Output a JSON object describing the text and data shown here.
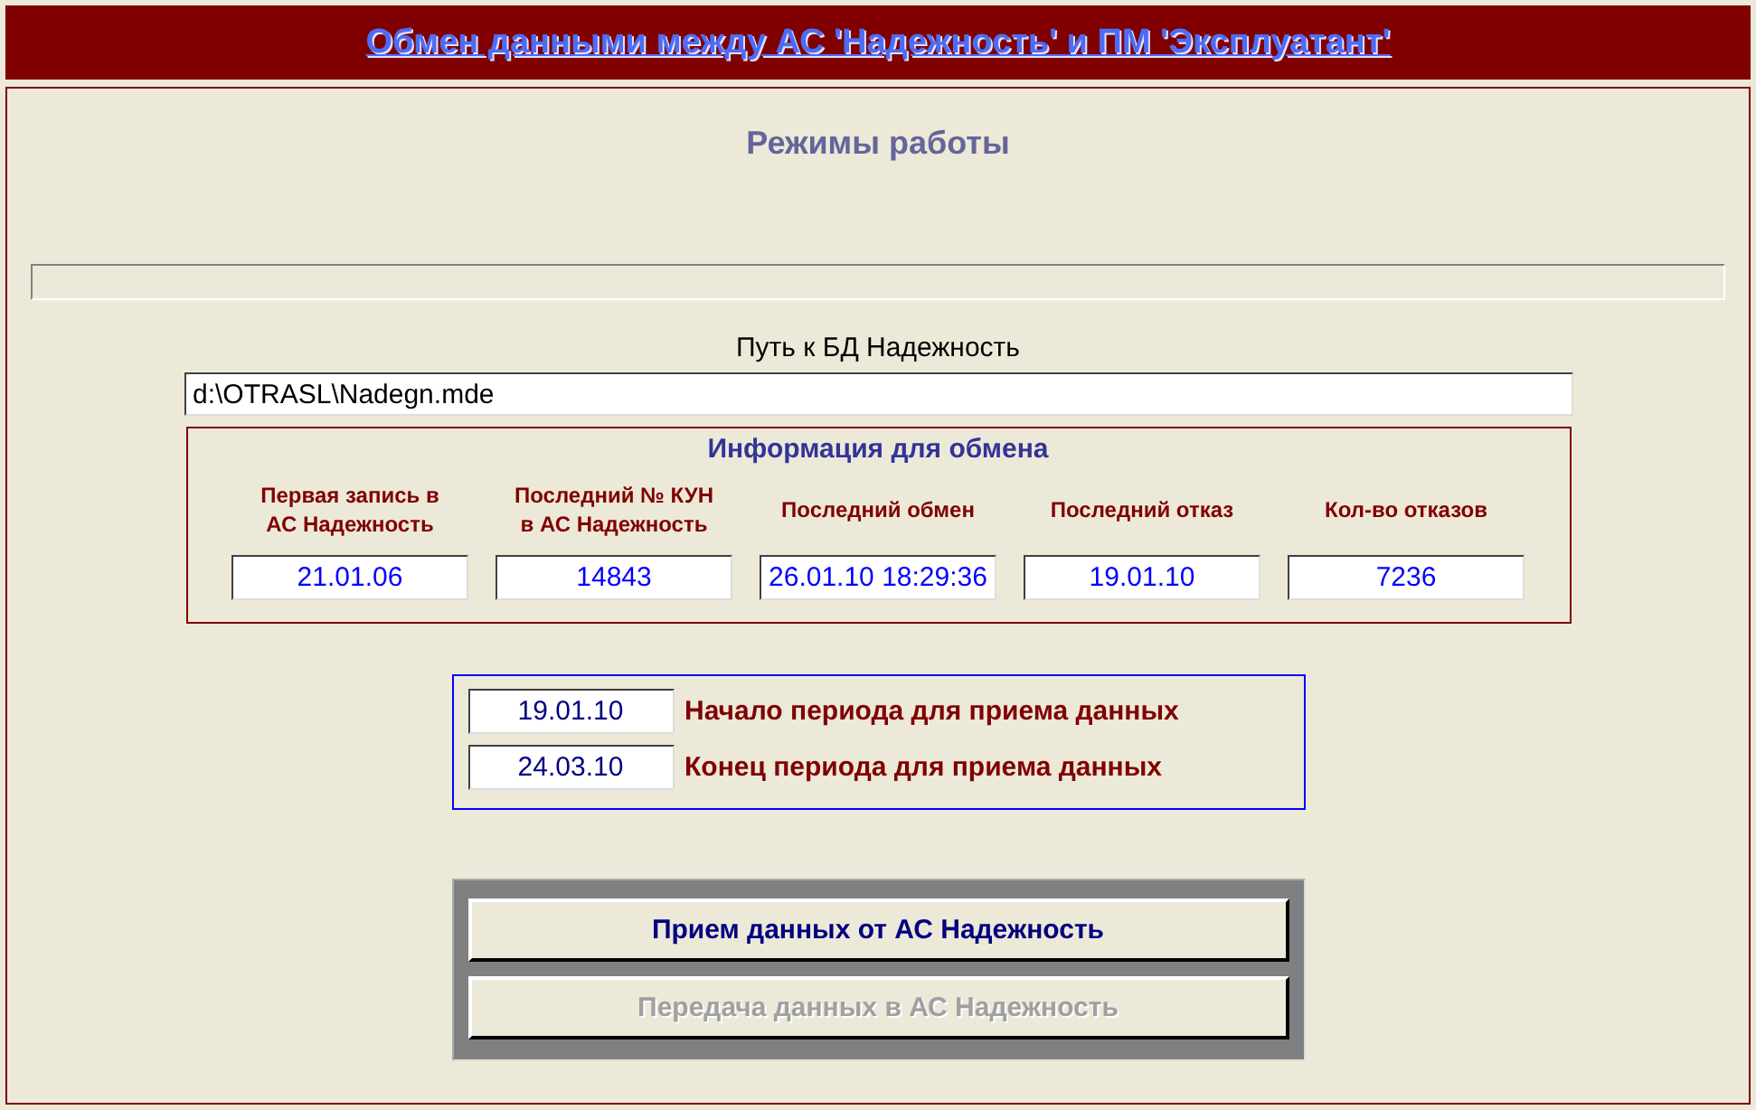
{
  "header": {
    "title": "Обмен данными между АС 'Надежность' и ПМ 'Эксплуатант'"
  },
  "panel_title": "Режимы работы",
  "progress": {
    "level": 0
  },
  "db_path": {
    "label": "Путь к БД Надежность",
    "value": "d:\\OTRASL\\Nadegn.mde"
  },
  "exchange_info": {
    "title": "Информация для обмена",
    "fields": [
      {
        "label": "Первая запись в АС Надежность",
        "value": "21.01.06"
      },
      {
        "label": "Последний № КУН в АС Надежность",
        "value": "14843"
      },
      {
        "label": "Последний обмен",
        "value": "26.01.10 18:29:36"
      },
      {
        "label": "Последний отказ",
        "value": "19.01.10"
      },
      {
        "label": "Кол-во отказов",
        "value": "7236"
      }
    ]
  },
  "period": [
    {
      "value": "19.01.10",
      "label": "Начало периода для приема данных"
    },
    {
      "value": "24.03.10",
      "label": "Конец периода для приема данных"
    }
  ],
  "buttons": [
    {
      "label": "Прием данных от АС Надежность",
      "disabled": false
    },
    {
      "label": "Передача данных в АС Надежность",
      "disabled": true
    }
  ]
}
